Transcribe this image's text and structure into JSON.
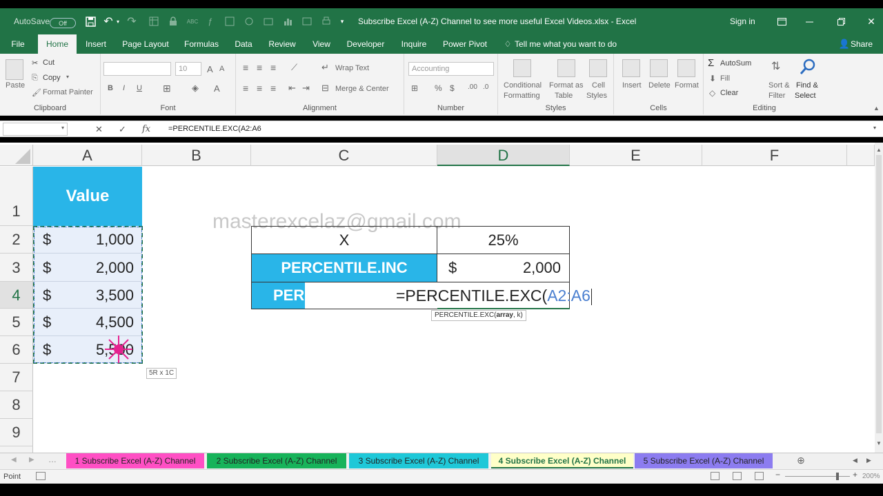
{
  "title_bar": {
    "autosave_label": "AutoSave",
    "autosave_state": "Off",
    "document_title": "Subscribe Excel (A-Z) Channel to see more useful Excel Videos.xlsx  -  Excel",
    "sign_in": "Sign in"
  },
  "ribbon_tabs": [
    "File",
    "Home",
    "Insert",
    "Page Layout",
    "Formulas",
    "Data",
    "Review",
    "View",
    "Developer",
    "Inquire",
    "Power Pivot"
  ],
  "tell_me": "Tell me what you want to do",
  "share": "Share",
  "clipboard": {
    "paste": "Paste",
    "cut": "Cut",
    "copy": "Copy",
    "format_painter": "Format Painter",
    "label": "Clipboard"
  },
  "font": {
    "size": "10",
    "label": "Font"
  },
  "alignment": {
    "wrap_text": "Wrap Text",
    "merge_center": "Merge & Center",
    "label": "Alignment"
  },
  "number": {
    "format": "Accounting",
    "label": "Number"
  },
  "styles": {
    "conditional": "Conditional",
    "formatting": "Formatting",
    "format_as": "Format as",
    "table": "Table",
    "cell": "Cell",
    "styles_word": "Styles",
    "label": "Styles"
  },
  "cells": {
    "insert": "Insert",
    "delete": "Delete",
    "format": "Format",
    "label": "Cells"
  },
  "editing": {
    "autosum": "AutoSum",
    "fill": "Fill",
    "clear": "Clear",
    "sort": "Sort &",
    "filter": "Filter",
    "find": "Find &",
    "select": "Select",
    "label": "Editing"
  },
  "formula_bar": {
    "formula": "=PERCENTILE.EXC(A2:A6"
  },
  "columns": [
    "A",
    "B",
    "C",
    "D",
    "E",
    "F"
  ],
  "rows": [
    "1",
    "2",
    "3",
    "4",
    "5",
    "6",
    "7",
    "8",
    "9"
  ],
  "sheet": {
    "header_value": "Value",
    "values": [
      {
        "cur": "$",
        "num": "1,000"
      },
      {
        "cur": "$",
        "num": "2,000"
      },
      {
        "cur": "$",
        "num": "3,500"
      },
      {
        "cur": "$",
        "num": "4,500"
      },
      {
        "cur": "$",
        "num": "5,500"
      }
    ],
    "watermark": "masterexcelaz@gmail.com",
    "x_label": "X",
    "x_value": "25%",
    "inc_label": "PERCENTILE.INC",
    "inc_cur": "$",
    "inc_value": "2,000",
    "exc_label_visible": "PER",
    "formula_prefix": "=PERCENTILE.EXC(",
    "formula_ref": "A2:A6",
    "tooltip_fn": "PERCENTILE.EXC(",
    "tooltip_arg1": "array",
    "tooltip_rest": ", k)",
    "selection_size": "5R x 1C"
  },
  "sheet_tabs": [
    {
      "label": "1 Subscribe Excel (A-Z) Channel",
      "color": "#ff4fc4"
    },
    {
      "label": "2 Subscribe Excel (A-Z) Channel",
      "color": "#17b35a"
    },
    {
      "label": "3 Subscribe Excel (A-Z) Channel",
      "color": "#1ec8d8"
    },
    {
      "label": "4 Subscribe Excel (A-Z) Channel",
      "color": "#ffffc8"
    },
    {
      "label": "5 Subscribe Excel (A-Z) Channel",
      "color": "#8c7cf0"
    }
  ],
  "status": {
    "mode": "Point",
    "zoom": "200%"
  },
  "colors": {
    "excel_green": "#217346",
    "header_blue": "#29b5e8",
    "selection_fill": "#e8effa"
  }
}
